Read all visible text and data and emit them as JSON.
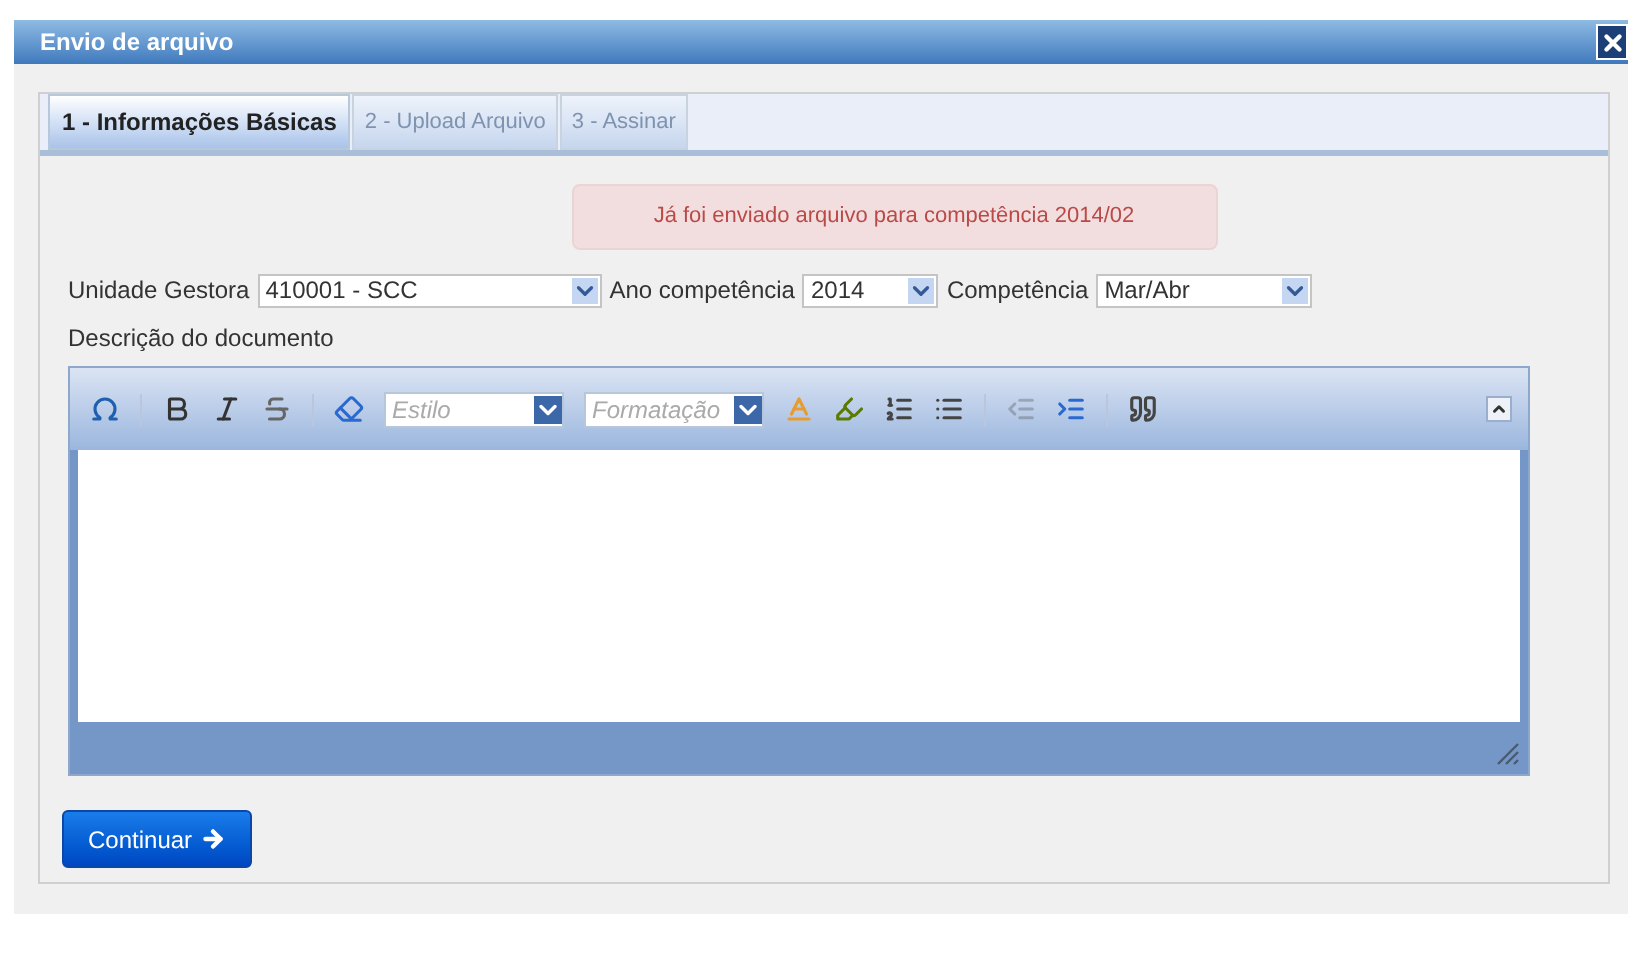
{
  "window": {
    "title": "Envio de arquivo"
  },
  "tabs": [
    {
      "label": "1 - Informações Básicas",
      "selected": true
    },
    {
      "label": "2 - Upload Arquivo",
      "selected": false
    },
    {
      "label": "3 - Assinar",
      "selected": false
    }
  ],
  "alert": {
    "text": "Já foi enviado arquivo para competência 2014/02"
  },
  "fields": [
    {
      "label": "Unidade Gestora",
      "value": "410001 - SCC"
    },
    {
      "label": "Ano competência",
      "value": "2014"
    },
    {
      "label": "Competência",
      "value": "Mar/Abr"
    }
  ],
  "editor": {
    "label": "Descrição do documento",
    "toolbar": [
      {
        "kind": "special-char",
        "disabled": false
      },
      {
        "kind": "separator"
      },
      {
        "kind": "bold",
        "disabled": false
      },
      {
        "kind": "italic",
        "disabled": false
      },
      {
        "kind": "strike",
        "disabled": false
      },
      {
        "kind": "separator"
      },
      {
        "kind": "eraser",
        "disabled": false
      },
      {
        "kind": "combo",
        "placeholder": "Estilo"
      },
      {
        "kind": "combo",
        "placeholder": "Formatação"
      },
      {
        "kind": "text-color",
        "disabled": false
      },
      {
        "kind": "bg-color",
        "disabled": false
      },
      {
        "kind": "numbered-list",
        "disabled": false
      },
      {
        "kind": "bullet-list",
        "disabled": false
      },
      {
        "kind": "separator"
      },
      {
        "kind": "outdent",
        "disabled": true
      },
      {
        "kind": "indent",
        "disabled": false
      },
      {
        "kind": "separator"
      },
      {
        "kind": "blockquote",
        "disabled": false
      }
    ]
  },
  "buttons": [
    {
      "label": "Continuar"
    }
  ]
}
